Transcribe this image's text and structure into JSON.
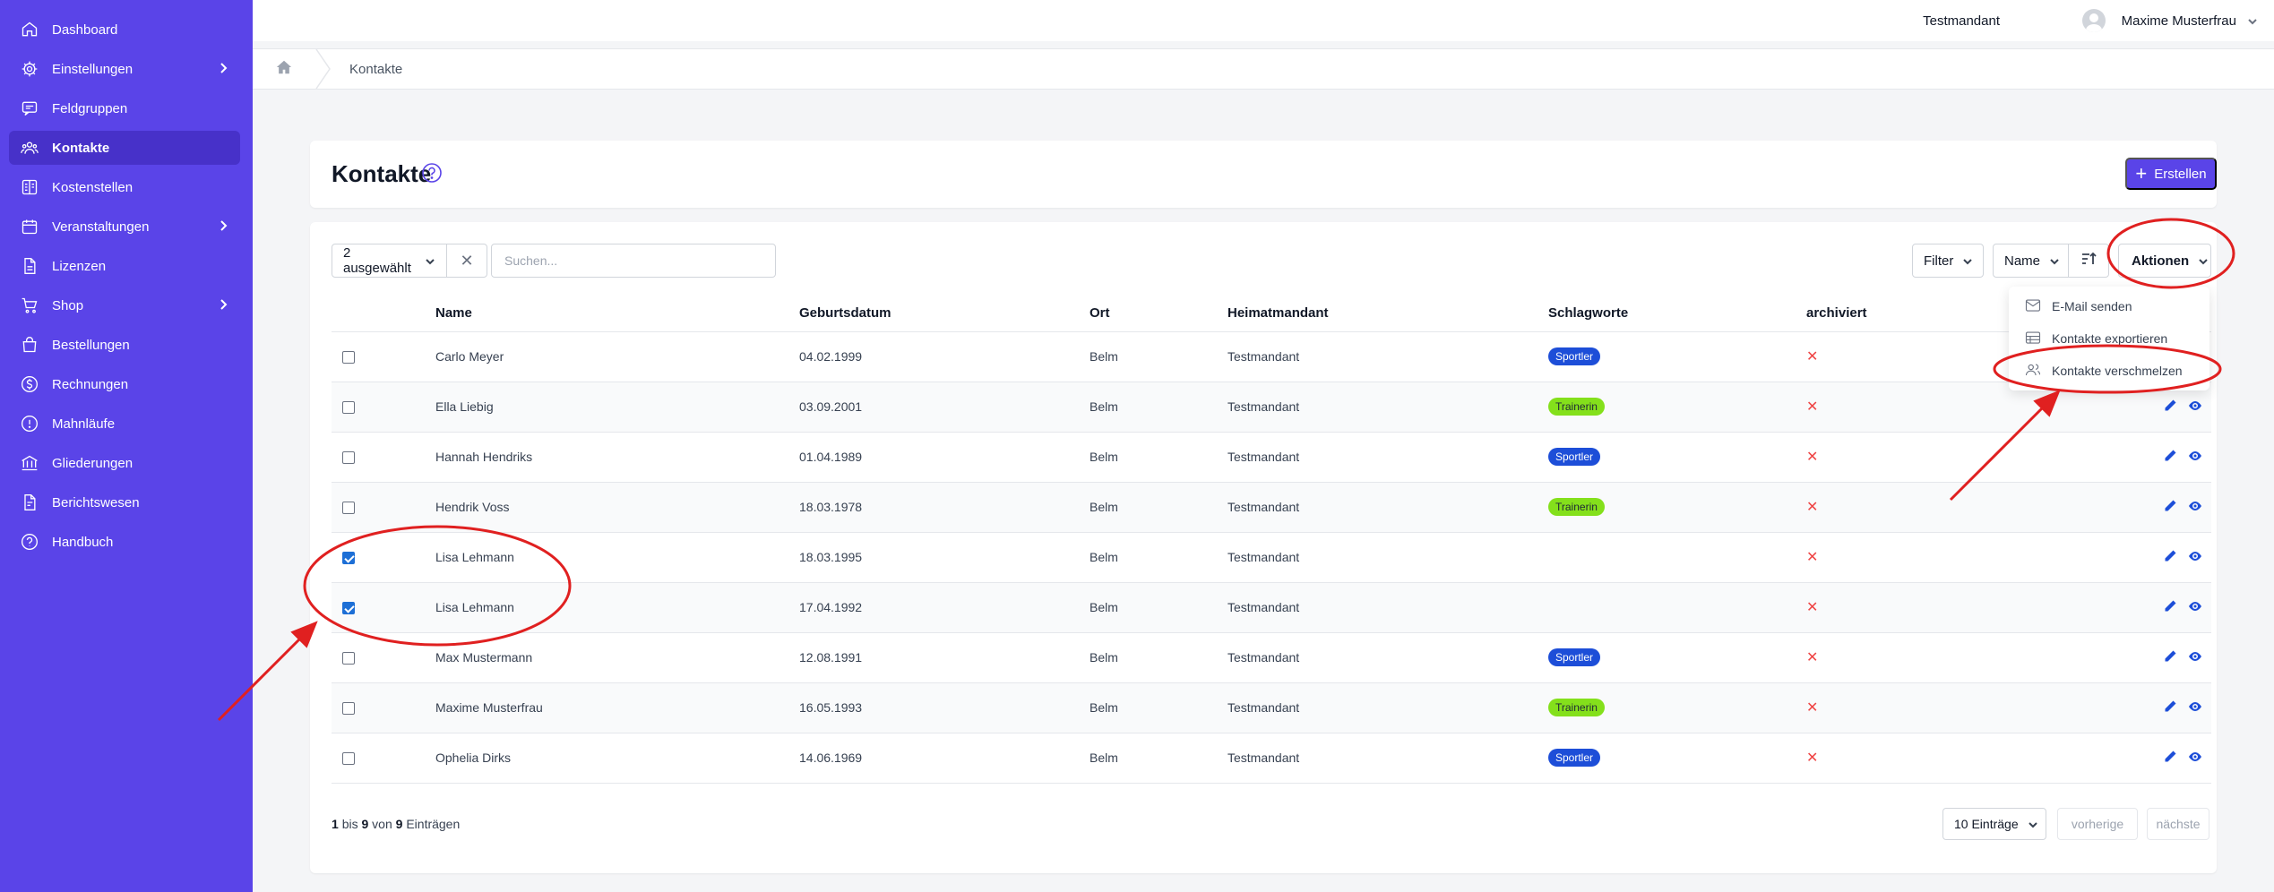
{
  "sidebar": {
    "items": [
      {
        "label": "Dashboard",
        "icon": "home-icon",
        "active": false,
        "has_children": false
      },
      {
        "label": "Einstellungen",
        "icon": "gear-icon",
        "active": false,
        "has_children": true
      },
      {
        "label": "Feldgruppen",
        "icon": "chat-icon",
        "active": false,
        "has_children": false
      },
      {
        "label": "Kontakte",
        "icon": "users-icon",
        "active": true,
        "has_children": false
      },
      {
        "label": "Kostenstellen",
        "icon": "ledger-icon",
        "active": false,
        "has_children": false
      },
      {
        "label": "Veranstaltungen",
        "icon": "calendar-icon",
        "active": false,
        "has_children": true
      },
      {
        "label": "Lizenzen",
        "icon": "document-icon",
        "active": false,
        "has_children": false
      },
      {
        "label": "Shop",
        "icon": "cart-icon",
        "active": false,
        "has_children": true
      },
      {
        "label": "Bestellungen",
        "icon": "bag-icon",
        "active": false,
        "has_children": false
      },
      {
        "label": "Rechnungen",
        "icon": "dollar-icon",
        "active": false,
        "has_children": false
      },
      {
        "label": "Mahnläufe",
        "icon": "alert-icon",
        "active": false,
        "has_children": false
      },
      {
        "label": "Gliederungen",
        "icon": "bank-icon",
        "active": false,
        "has_children": false
      },
      {
        "label": "Berichtswesen",
        "icon": "report-icon",
        "active": false,
        "has_children": false
      },
      {
        "label": "Handbuch",
        "icon": "help-icon",
        "active": false,
        "has_children": false
      }
    ]
  },
  "topbar": {
    "tenant": "Testmandant",
    "user_name": "Maxime Musterfrau"
  },
  "breadcrumb": {
    "current": "Kontakte"
  },
  "header": {
    "title": "Kontakte",
    "create_label": "Erstellen"
  },
  "toolbar": {
    "selected_label": "2 ausgewählt",
    "search_placeholder": "Suchen...",
    "filter_label": "Filter",
    "sort_label": "Name",
    "actions_label": "Aktionen"
  },
  "actions_menu": {
    "items": [
      {
        "label": "E-Mail senden",
        "icon": "mail-icon"
      },
      {
        "label": "Kontakte exportieren",
        "icon": "table-icon"
      },
      {
        "label": "Kontakte verschmelzen",
        "icon": "merge-users-icon"
      }
    ]
  },
  "table": {
    "columns": [
      "Name",
      "Geburtsdatum",
      "Ort",
      "Heimatmandant",
      "Schlagworte",
      "archiviert"
    ],
    "rows": [
      {
        "checked": false,
        "name": "Carlo Meyer",
        "birth": "04.02.1999",
        "city": "Belm",
        "home": "Testmandant",
        "tag": "Sportler",
        "tag_color": "blue"
      },
      {
        "checked": false,
        "name": "Ella Liebig",
        "birth": "03.09.2001",
        "city": "Belm",
        "home": "Testmandant",
        "tag": "Trainerin",
        "tag_color": "green"
      },
      {
        "checked": false,
        "name": "Hannah Hendriks",
        "birth": "01.04.1989",
        "city": "Belm",
        "home": "Testmandant",
        "tag": "Sportler",
        "tag_color": "blue"
      },
      {
        "checked": false,
        "name": "Hendrik Voss",
        "birth": "18.03.1978",
        "city": "Belm",
        "home": "Testmandant",
        "tag": "Trainerin",
        "tag_color": "green"
      },
      {
        "checked": true,
        "name": "Lisa Lehmann",
        "birth": "18.03.1995",
        "city": "Belm",
        "home": "Testmandant",
        "tag": "",
        "tag_color": ""
      },
      {
        "checked": true,
        "name": "Lisa Lehmann",
        "birth": "17.04.1992",
        "city": "Belm",
        "home": "Testmandant",
        "tag": "",
        "tag_color": ""
      },
      {
        "checked": false,
        "name": "Max Mustermann",
        "birth": "12.08.1991",
        "city": "Belm",
        "home": "Testmandant",
        "tag": "Sportler",
        "tag_color": "blue"
      },
      {
        "checked": false,
        "name": "Maxime Musterfrau",
        "birth": "16.05.1993",
        "city": "Belm",
        "home": "Testmandant",
        "tag": "Trainerin",
        "tag_color": "green"
      },
      {
        "checked": false,
        "name": "Ophelia Dirks",
        "birth": "14.06.1969",
        "city": "Belm",
        "home": "Testmandant",
        "tag": "Sportler",
        "tag_color": "blue"
      }
    ],
    "archived_mark": "✕"
  },
  "footer": {
    "range_start": "1",
    "range_end": "9",
    "total": "9",
    "text_bis": "bis",
    "text_von": "von",
    "text_entries": "Einträgen",
    "page_size_label": "10 Einträge",
    "prev_label": "vorherige",
    "next_label": "nächste"
  },
  "colors": {
    "sidebar_bg": "#5a44e8",
    "accent": "#5a44e8",
    "badge_blue": "#1d4ed8",
    "badge_green": "#84e01b",
    "annotation_red": "#e02020"
  }
}
